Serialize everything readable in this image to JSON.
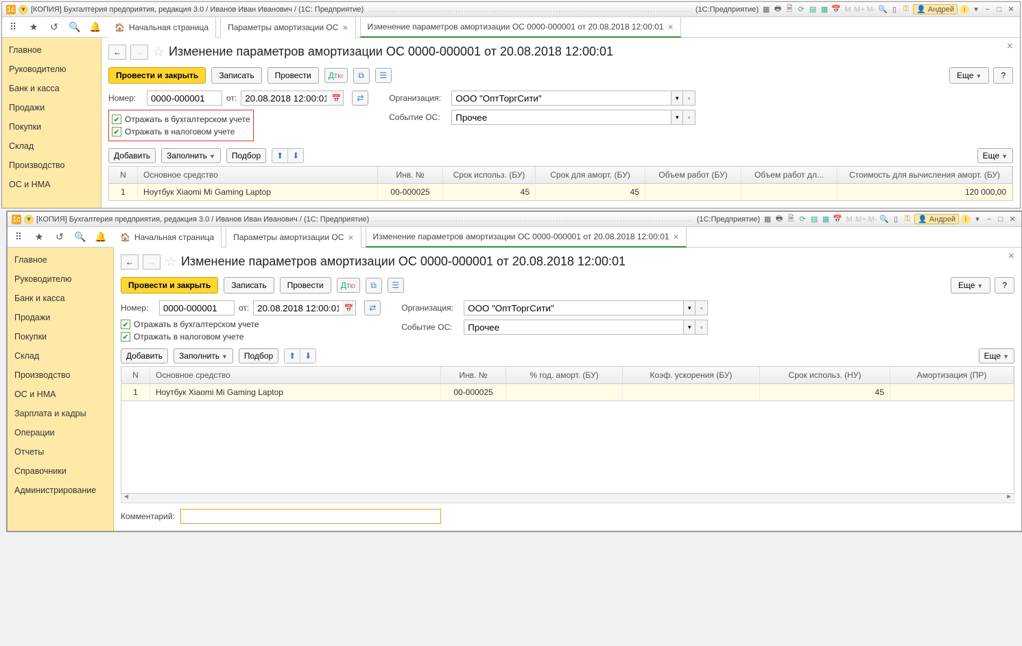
{
  "window": {
    "title": "[КОПИЯ] Бухгалтерия предприятия, редакция 3.0 / Иванов Иван Иванович / (1С: Предприятие)",
    "product": "(1С:Предприятие)",
    "user": "Андрей"
  },
  "tabs": {
    "home": "Начальная страница",
    "t1": "Параметры амортизации ОС",
    "t2": "Изменение параметров амортизации ОС 0000-000001 от 20.08.2018 12:00:01"
  },
  "sidebar": {
    "i0": "Главное",
    "i1": "Руководителю",
    "i2": "Банк и касса",
    "i3": "Продажи",
    "i4": "Покупки",
    "i5": "Склад",
    "i6": "Производство",
    "i7": "ОС и НМА",
    "i8": "Зарплата и кадры",
    "i9": "Операции",
    "i10": "Отчеты",
    "i11": "Справочники",
    "i12": "Администрирование"
  },
  "form": {
    "title": "Изменение параметров амортизации ОС 0000-000001 от 20.08.2018 12:00:01",
    "post_close": "Провести и закрыть",
    "save": "Записать",
    "post": "Провести",
    "more": "Еще",
    "help": "?",
    "number_lbl": "Номер:",
    "number": "0000-000001",
    "date_lbl": "от:",
    "date": "20.08.2018 12:00:01",
    "org_lbl": "Организация:",
    "org": "ООО \"ОптТоргСити\"",
    "event_lbl": "Событие ОС:",
    "event": "Прочее",
    "chk_bu": "Отражать в бухгалтерском учете",
    "chk_nu": "Отражать в налоговом учете",
    "add": "Добавить",
    "fill": "Заполнить",
    "pick": "Подбор",
    "comment_lbl": "Комментарий:"
  },
  "table1": {
    "h_n": "N",
    "h_asset": "Основное средство",
    "h_inv": "Инв. №",
    "h_srok": "Срок использ. (БУ)",
    "h_srokam": "Срок для аморт. (БУ)",
    "h_ob": "Объем работ (БУ)",
    "h_obdl": "Объем работ дл...",
    "h_cost": "Стоимость для вычисления аморт. (БУ)",
    "r1_n": "1",
    "r1_asset": "Ноутбук Xiaomi Mi Gaming Laptop",
    "r1_inv": "00-000025",
    "r1_srok": "45",
    "r1_srokam": "45",
    "r1_cost": "120 000,00"
  },
  "table2": {
    "h_n": "N",
    "h_asset": "Основное средство",
    "h_inv": "Инв. №",
    "h_pct": "% год. аморт. (БУ)",
    "h_coef": "Коэф. ускорения (БУ)",
    "h_sroknu": "Срок использ. (НУ)",
    "h_apr": "Амортизация (ПР)",
    "r1_n": "1",
    "r1_asset": "Ноутбук Xiaomi Mi Gaming Laptop",
    "r1_inv": "00-000025",
    "r1_sroknu": "45"
  }
}
